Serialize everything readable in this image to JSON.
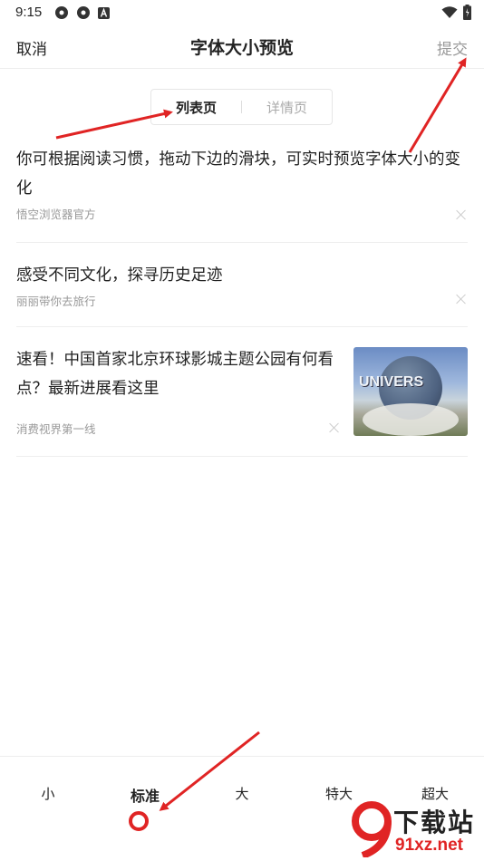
{
  "status_bar": {
    "time": "9:15",
    "icons": [
      "app-icon",
      "app-icon",
      "a-icon",
      "wifi-icon",
      "battery-icon"
    ]
  },
  "header": {
    "cancel_label": "取消",
    "title": "字体大小预览",
    "submit_label": "提交"
  },
  "tabs": [
    {
      "label": "列表页",
      "active": true
    },
    {
      "label": "详情页",
      "active": false
    }
  ],
  "news": [
    {
      "title": "你可根据阅读习惯，拖动下边的滑块，可实时预览字体大小的变化",
      "source": "悟空浏览器官方"
    },
    {
      "title": "感受不同文化，探寻历史足迹",
      "source": "丽丽带你去旅行"
    },
    {
      "title": "速看！中国首家北京环球影城主题公园有何看点？最新进展看这里",
      "source": "消费视界第一线",
      "thumbnail_text": "UNIVERS"
    }
  ],
  "font_sizes": {
    "options": [
      "小",
      "标准",
      "大",
      "特大",
      "超大"
    ],
    "selected": "标准",
    "selected_index": 1
  },
  "watermark": {
    "text": "下载站",
    "url": "91xz.net"
  },
  "colors": {
    "accent": "#e02424",
    "text": "#222222",
    "muted": "#999999"
  }
}
